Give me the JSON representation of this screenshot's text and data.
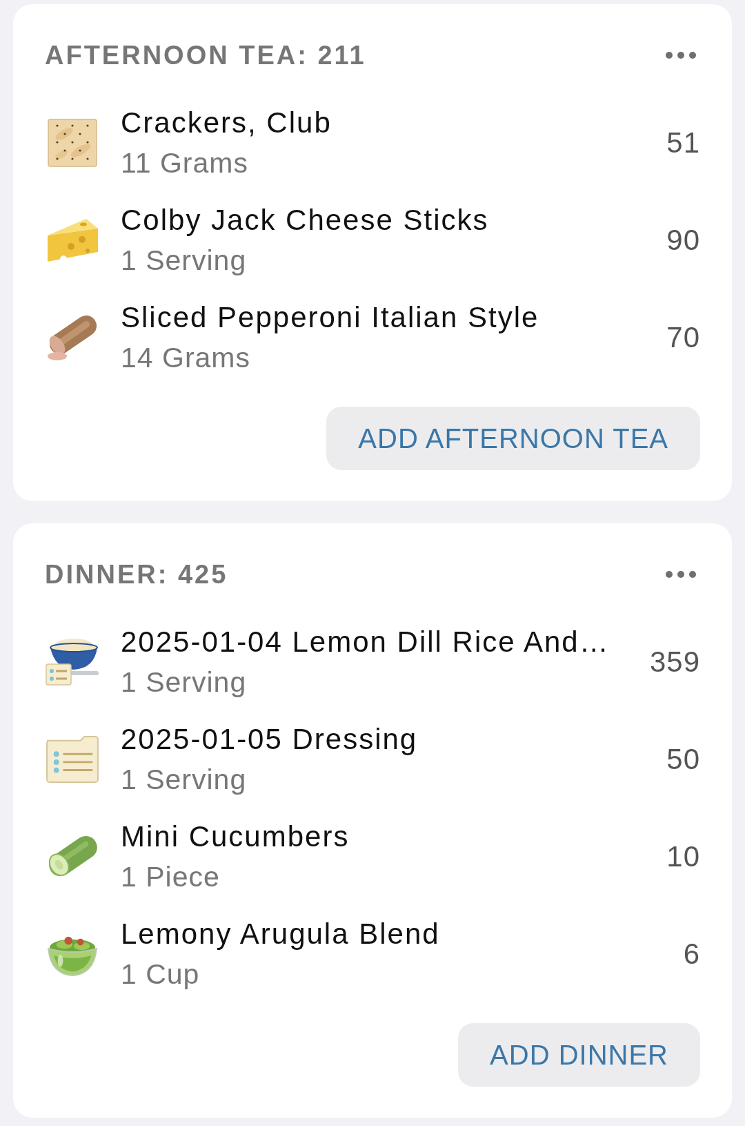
{
  "meals": [
    {
      "header": "AFTERNOON TEA: 211",
      "items": [
        {
          "kind": "cracker",
          "name": "Crackers, Club",
          "serving": "11 Grams",
          "calories": "51"
        },
        {
          "kind": "cheese",
          "name": "Colby Jack Cheese Sticks",
          "serving": "1 Serving",
          "calories": "90"
        },
        {
          "kind": "sausage",
          "name": "Sliced Pepperoni Italian Style",
          "serving": "14 Grams",
          "calories": "70"
        }
      ],
      "add_button": "ADD AFTERNOON TEA"
    },
    {
      "header": "DINNER: 425",
      "items": [
        {
          "kind": "dish",
          "name": "2025-01-04 Lemon Dill Rice And…",
          "serving": "1 Serving",
          "calories": "359"
        },
        {
          "kind": "recipe",
          "name": "2025-01-05 Dressing",
          "serving": "1 Serving",
          "calories": "50"
        },
        {
          "kind": "cucumber",
          "name": "Mini Cucumbers",
          "serving": "1 Piece",
          "calories": "10"
        },
        {
          "kind": "salad",
          "name": "Lemony Arugula Blend",
          "serving": "1 Cup",
          "calories": "6"
        }
      ],
      "add_button": "ADD DINNER"
    }
  ]
}
